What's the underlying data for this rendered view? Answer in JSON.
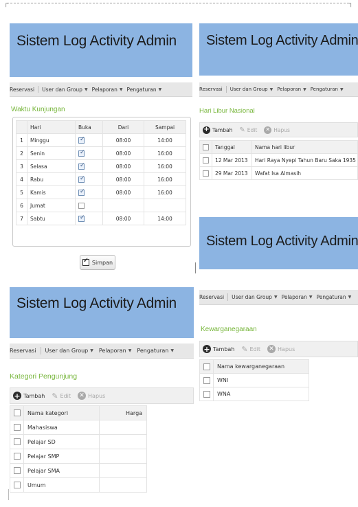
{
  "app_title": "Sistem Log Activity Admin",
  "menu": {
    "reservasi": "Reservasi",
    "user_group": "User dan Group",
    "pelaporan": "Pelaporan",
    "pengaturan": "Pengaturan"
  },
  "toolbar": {
    "tambah": "Tambah",
    "edit": "Edit",
    "hapus": "Hapus"
  },
  "waktu": {
    "title": "Waktu Kunjungan",
    "headers": [
      "Hari",
      "Buka",
      "Dari",
      "Sampai"
    ],
    "rows": [
      {
        "no": "1",
        "hari": "Minggu",
        "buka": true,
        "dari": "08:00",
        "sampai": "14:00"
      },
      {
        "no": "2",
        "hari": "Senin",
        "buka": true,
        "dari": "08:00",
        "sampai": "16:00"
      },
      {
        "no": "3",
        "hari": "Selasa",
        "buka": true,
        "dari": "08:00",
        "sampai": "16:00"
      },
      {
        "no": "4",
        "hari": "Rabu",
        "buka": true,
        "dari": "08:00",
        "sampai": "16:00"
      },
      {
        "no": "5",
        "hari": "Kamis",
        "buka": true,
        "dari": "08:00",
        "sampai": "16:00"
      },
      {
        "no": "6",
        "hari": "Jumat",
        "buka": false,
        "dari": "",
        "sampai": ""
      },
      {
        "no": "7",
        "hari": "Sabtu",
        "buka": true,
        "dari": "08:00",
        "sampai": "14:00"
      }
    ],
    "save_label": "Simpan"
  },
  "libur": {
    "title": "Hari Libur Nasional",
    "headers": [
      "Tanggal",
      "Nama hari libur"
    ],
    "rows": [
      {
        "tanggal": "12 Mar 2013",
        "nama": "Hari Raya Nyepi Tahun Baru Saka 1935"
      },
      {
        "tanggal": "29 Mar 2013",
        "nama": "Wafat Isa Almasih"
      }
    ]
  },
  "kategori": {
    "title": "Kategori Pengunjung",
    "headers": [
      "Nama kategori",
      "Harga"
    ],
    "rows": [
      "Mahasiswa",
      "Pelajar SD",
      "Pelajar SMP",
      "Pelajar SMA",
      "Umum"
    ]
  },
  "kewarga": {
    "title": "Kewarganegaraan",
    "headers": [
      "Nama kewarganegaraan"
    ],
    "rows": [
      "WNI",
      "WNA"
    ]
  }
}
